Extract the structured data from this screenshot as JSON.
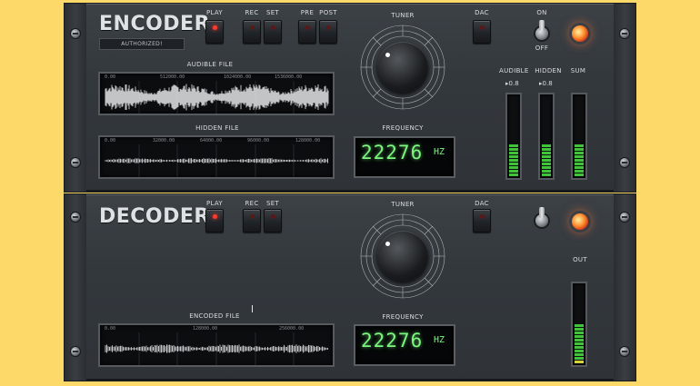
{
  "colors": {
    "background": "#fdd96a",
    "panel": "#33383d",
    "led_on": "#ff3b2f",
    "digits": "#7bf67f",
    "meter_green": "#3fc43a",
    "lamp": "#ff8b2a"
  },
  "encoder": {
    "title": "ENCODER",
    "badge": "AUTHORIZED!",
    "buttons": {
      "play": "PLAY",
      "rec": "REC",
      "set": "SET",
      "pre": "PRE",
      "post": "POST",
      "dac": "DAC"
    },
    "tuner_label": "TUNER",
    "power": {
      "on": "ON",
      "off": "OFF"
    },
    "audible_file": {
      "label": "AUDIBLE FILE",
      "ticks": [
        "0.00",
        "512000.00",
        "1024000.00",
        "1536000.00"
      ]
    },
    "hidden_file": {
      "label": "HIDDEN FILE",
      "ticks": [
        "0.00",
        "32000.00",
        "64000.00",
        "96000.00",
        "128000.00"
      ]
    },
    "frequency": {
      "label": "FREQUENCY",
      "value": "22276",
      "unit": "HZ"
    },
    "meters": [
      {
        "label": "AUDIBLE",
        "value": "0.8",
        "level": 0.45
      },
      {
        "label": "HIDDEN",
        "value": "0.8",
        "level": 0.45
      },
      {
        "label": "SUM",
        "value": "",
        "level": 0.45
      }
    ]
  },
  "decoder": {
    "title": "DECODER",
    "buttons": {
      "play": "PLAY",
      "rec": "REC",
      "set": "SET",
      "dac": "DAC"
    },
    "tuner_label": "TUNER",
    "encoded_file": {
      "label": "ENCODED FILE",
      "ticks": [
        "0.00",
        "128000.00",
        "256000.00"
      ]
    },
    "frequency": {
      "label": "FREQUENCY",
      "value": "22276",
      "unit": "HZ"
    },
    "meters": [
      {
        "label": "OUT",
        "level": 0.55
      }
    ]
  }
}
